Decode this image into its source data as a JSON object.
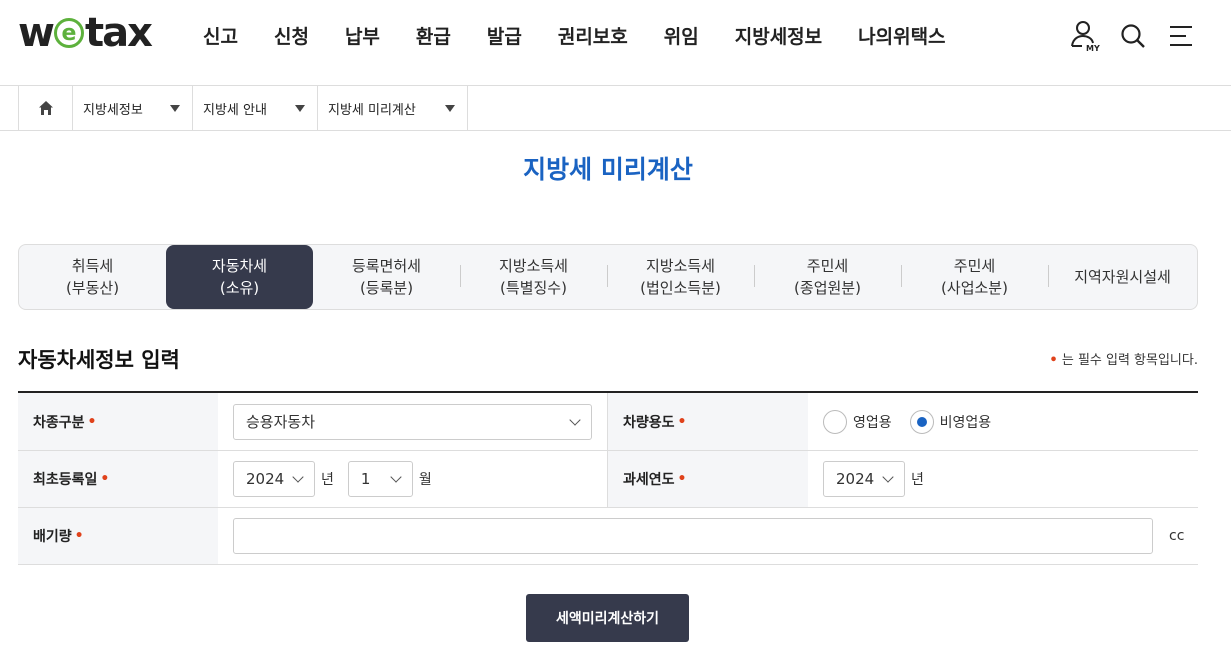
{
  "logo": {
    "pre": "w",
    "e": "e",
    "post": "tax"
  },
  "gnb": [
    "신고",
    "신청",
    "납부",
    "환급",
    "발급",
    "권리보호",
    "위임",
    "지방세정보",
    "나의위택스"
  ],
  "util": {
    "my_label": "MY"
  },
  "breadcrumb": [
    "지방세정보",
    "지방세 안내",
    "지방세 미리계산"
  ],
  "page_title": "지방세 미리계산",
  "tabs": [
    {
      "l1": "취득세",
      "l2": "(부동산)"
    },
    {
      "l1": "자동차세",
      "l2": "(소유)"
    },
    {
      "l1": "등록면허세",
      "l2": "(등록분)"
    },
    {
      "l1": "지방소득세",
      "l2": "(특별징수)"
    },
    {
      "l1": "지방소득세",
      "l2": "(법인소득분)"
    },
    {
      "l1": "주민세",
      "l2": "(종업원분)"
    },
    {
      "l1": "주민세",
      "l2": "(사업소분)"
    },
    {
      "l1": "지역자원시설세",
      "l2": ""
    }
  ],
  "section_title": "자동차세정보 입력",
  "required_note": "는 필수 입력 항목입니다.",
  "required_mark": "•",
  "form": {
    "vehicle_type_label": "차종구분",
    "vehicle_type_value": "승용자동차",
    "usage_label": "차량용도",
    "usage_options": [
      "영업용",
      "비영업용"
    ],
    "first_reg_label": "최초등록일",
    "first_reg_year": "2024",
    "year_unit": "년",
    "first_reg_month": "1",
    "month_unit": "월",
    "tax_year_label": "과세연도",
    "tax_year_value": "2024",
    "displacement_label": "배기량",
    "displacement_unit": "cc"
  },
  "calc_button": "세액미리계산하기",
  "colors": {
    "primary_blue": "#1a63c2",
    "dark_navy": "#363a4c",
    "logo_green": "#5db13c",
    "required_red": "#e0421b"
  }
}
